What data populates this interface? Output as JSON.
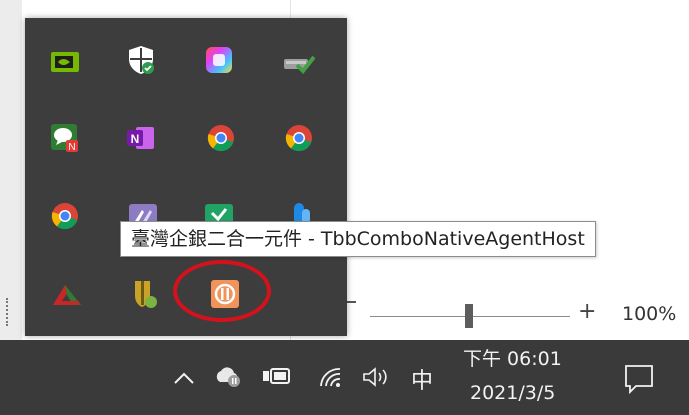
{
  "tooltip": {
    "text": "臺灣企銀二合一元件 - TbbComboNativeAgentHost"
  },
  "zoom": {
    "plus_label": "+",
    "level": "100%"
  },
  "taskbar": {
    "clock_time": "下午 06:01",
    "clock_date": "2021/3/5",
    "ime_label": "中",
    "chevron_glyph": "⌃"
  },
  "tray_icons": [
    {
      "name": "nvidia-icon",
      "color": "#76b900"
    },
    {
      "name": "windows-security-icon",
      "color": "#ffffff"
    },
    {
      "name": "color-app-icon",
      "color": "#e040fb"
    },
    {
      "name": "drive-check-icon",
      "color": "#4caf50"
    },
    {
      "name": "chat-app-icon",
      "color": "#2e7d32"
    },
    {
      "name": "onenote-icon",
      "color": "#7719aa"
    },
    {
      "name": "chrome-icon",
      "color": "#4285f4"
    },
    {
      "name": "chrome-icon",
      "color": "#4285f4"
    },
    {
      "name": "chrome-icon",
      "color": "#4285f4"
    },
    {
      "name": "purple-app-icon",
      "color": "#8e7cc3"
    },
    {
      "name": "green-check-app-icon",
      "color": "#21a366"
    },
    {
      "name": "blue-app-icon",
      "color": "#1e88e5"
    },
    {
      "name": "red-green-app-icon",
      "color": "#c62828"
    },
    {
      "name": "shield-badge-icon",
      "color": "#c9a227"
    },
    {
      "name": "tbb-combo-agent-icon",
      "color": "#f2935a"
    }
  ]
}
